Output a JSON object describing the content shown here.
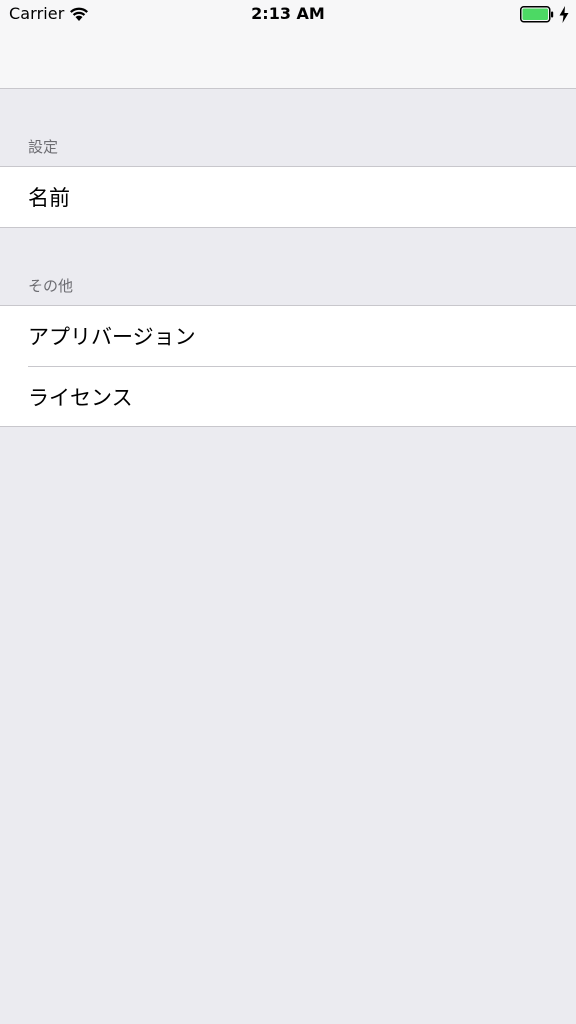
{
  "status_bar": {
    "carrier": "Carrier",
    "time": "2:13 AM",
    "wifi_icon": "wifi-icon",
    "battery_icon": "battery-charging-icon",
    "battery_color": "#4cd964"
  },
  "sections": [
    {
      "header": "設定",
      "items": [
        {
          "label": "名前"
        }
      ]
    },
    {
      "header": "その他",
      "items": [
        {
          "label": "アプリバージョン"
        },
        {
          "label": "ライセンス"
        }
      ]
    }
  ]
}
